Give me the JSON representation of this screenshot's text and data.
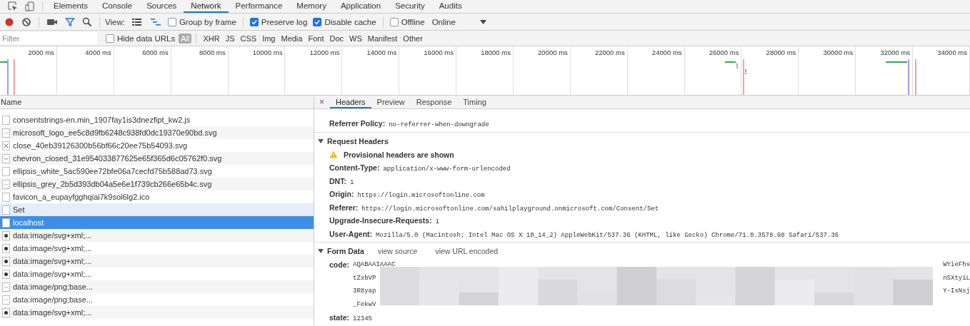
{
  "devtools_tabs": [
    {
      "label": "Elements",
      "selected": false
    },
    {
      "label": "Console",
      "selected": false
    },
    {
      "label": "Sources",
      "selected": false
    },
    {
      "label": "Network",
      "selected": true
    },
    {
      "label": "Performance",
      "selected": false
    },
    {
      "label": "Memory",
      "selected": false
    },
    {
      "label": "Application",
      "selected": false
    },
    {
      "label": "Security",
      "selected": false
    },
    {
      "label": "Audits",
      "selected": false
    }
  ],
  "toolbar": {
    "recording": true,
    "filter_active": true,
    "view_label": "View:",
    "views": [
      {
        "kind": "list",
        "selected": false
      },
      {
        "kind": "waterfall",
        "selected": true
      }
    ],
    "options": [
      {
        "label": "Group by frame",
        "checked": false
      },
      {
        "label": "Preserve log",
        "checked": true
      },
      {
        "label": "Disable cache",
        "checked": true
      }
    ],
    "offline": {
      "label": "Offline",
      "checked": false
    },
    "throttling": "Online"
  },
  "filter_bar": {
    "placeholder": "Filter",
    "hide_data_urls": {
      "label": "Hide data URLs",
      "checked": false
    },
    "types": [
      {
        "label": "All",
        "selected": true
      },
      {
        "label": "XHR",
        "selected": false
      },
      {
        "label": "JS",
        "selected": false
      },
      {
        "label": "CSS",
        "selected": false
      },
      {
        "label": "Img",
        "selected": false
      },
      {
        "label": "Media",
        "selected": false
      },
      {
        "label": "Font",
        "selected": false
      },
      {
        "label": "Doc",
        "selected": false
      },
      {
        "label": "WS",
        "selected": false
      },
      {
        "label": "Manifest",
        "selected": false
      },
      {
        "label": "Other",
        "selected": false
      }
    ]
  },
  "timeline": {
    "ticks": [
      "2000 ms",
      "4000 ms",
      "6000 ms",
      "8000 ms",
      "10000 ms",
      "12000 ms",
      "14000 ms",
      "16000 ms",
      "18000 ms",
      "20000 ms",
      "22000 ms",
      "24000 ms",
      "26000 ms",
      "28000 ms",
      "30000 ms",
      "32000 ms",
      "34000 ms"
    ]
  },
  "requests": {
    "column": "Name",
    "rows": [
      {
        "name": "consentstrings-en.min_1907fay1is3dnezfipt_kw2.js",
        "kind": "file",
        "selected": false,
        "highlighted": false
      },
      {
        "name": "microsoft_logo_ee5c8d9fb6248c938fd0dc19370e90bd.svg",
        "kind": "dash",
        "selected": false,
        "highlighted": false
      },
      {
        "name": "close_40eb39126300b56bf66c20ee75b54093.svg",
        "kind": "cross",
        "selected": false,
        "highlighted": false
      },
      {
        "name": "chevron_closed_31e954033877625e65f365d6c05762f0.svg",
        "kind": "chevron",
        "selected": false,
        "highlighted": false
      },
      {
        "name": "ellipsis_white_5ac590ee72bfe06a7cecfd75b588ad73.svg",
        "kind": "file",
        "selected": false,
        "highlighted": false
      },
      {
        "name": "ellipsis_grey_2b5d393db04a5e6e1f739cb266e65b4c.svg",
        "kind": "dots",
        "selected": false,
        "highlighted": false
      },
      {
        "name": "favicon_a_eupayfgghqiai7k9sol6lg2.ico",
        "kind": "file",
        "selected": false,
        "highlighted": false
      },
      {
        "name": "Set",
        "kind": "file",
        "selected": false,
        "highlighted": true
      },
      {
        "name": "localhost",
        "kind": "file",
        "selected": true,
        "highlighted": false
      },
      {
        "name": "data:image/svg+xml;...",
        "kind": "glyph",
        "selected": false,
        "highlighted": false
      },
      {
        "name": "data:image/svg+xml;...",
        "kind": "glyph",
        "selected": false,
        "highlighted": false
      },
      {
        "name": "data:image/svg+xml;...",
        "kind": "glyph",
        "selected": false,
        "highlighted": false
      },
      {
        "name": "data:image/svg+xml;...",
        "kind": "glyph",
        "selected": false,
        "highlighted": false
      },
      {
        "name": "data:image/png;base...",
        "kind": "dash",
        "selected": false,
        "highlighted": false
      },
      {
        "name": "data:image/png;base...",
        "kind": "dash",
        "selected": false,
        "highlighted": false
      },
      {
        "name": "data:image/svg+xml;...",
        "kind": "glyph",
        "selected": false,
        "highlighted": false
      }
    ]
  },
  "detail": {
    "close": "×",
    "tabs": [
      {
        "label": "Headers",
        "selected": true
      },
      {
        "label": "Preview",
        "selected": false
      },
      {
        "label": "Response",
        "selected": false
      },
      {
        "label": "Timing",
        "selected": false
      }
    ],
    "general": [
      {
        "key": "Referrer Policy:",
        "value": "no-referrer-when-downgrade"
      }
    ],
    "sections": [
      {
        "title": "Request Headers",
        "expanded": true,
        "warning": "Provisional headers are shown",
        "entries": [
          {
            "key": "Content-Type:",
            "value": "application/x-www-form-urlencoded"
          },
          {
            "key": "DNT:",
            "value": "1"
          },
          {
            "key": "Origin:",
            "value": "https://login.microsoftonline.com"
          },
          {
            "key": "Referer:",
            "value": "https://login.microsoftonline.com/sahilplayground.onmicrosoft.com/Consent/Set"
          },
          {
            "key": "Upgrade-Insecure-Requests:",
            "value": "1"
          },
          {
            "key": "User-Agent:",
            "value": "Mozilla/5.0 (Macintosh; Intel Mac OS X 10_14_2) AppleWebKit/537.36 (KHTML, like Gecko) Chrome/71.0.3578.98 Safari/537.36"
          }
        ]
      },
      {
        "title": "Form Data",
        "expanded": true,
        "links": [
          "view source",
          "view URL encoded"
        ],
        "entries": [
          {
            "key": "code:",
            "redacted": true,
            "lines": [
              {
                "start": "AQABAAIAAAC",
                "end": "WYieFhs"
              },
              {
                "start": "tZsbVP",
                "end": "nSXtyiL"
              },
              {
                "start": "3R8yap",
                "end": "Y-IsNsj"
              },
              {
                "start": "_FekwV"
              }
            ]
          },
          {
            "key": "state:",
            "value": "12345"
          }
        ]
      }
    ]
  }
}
